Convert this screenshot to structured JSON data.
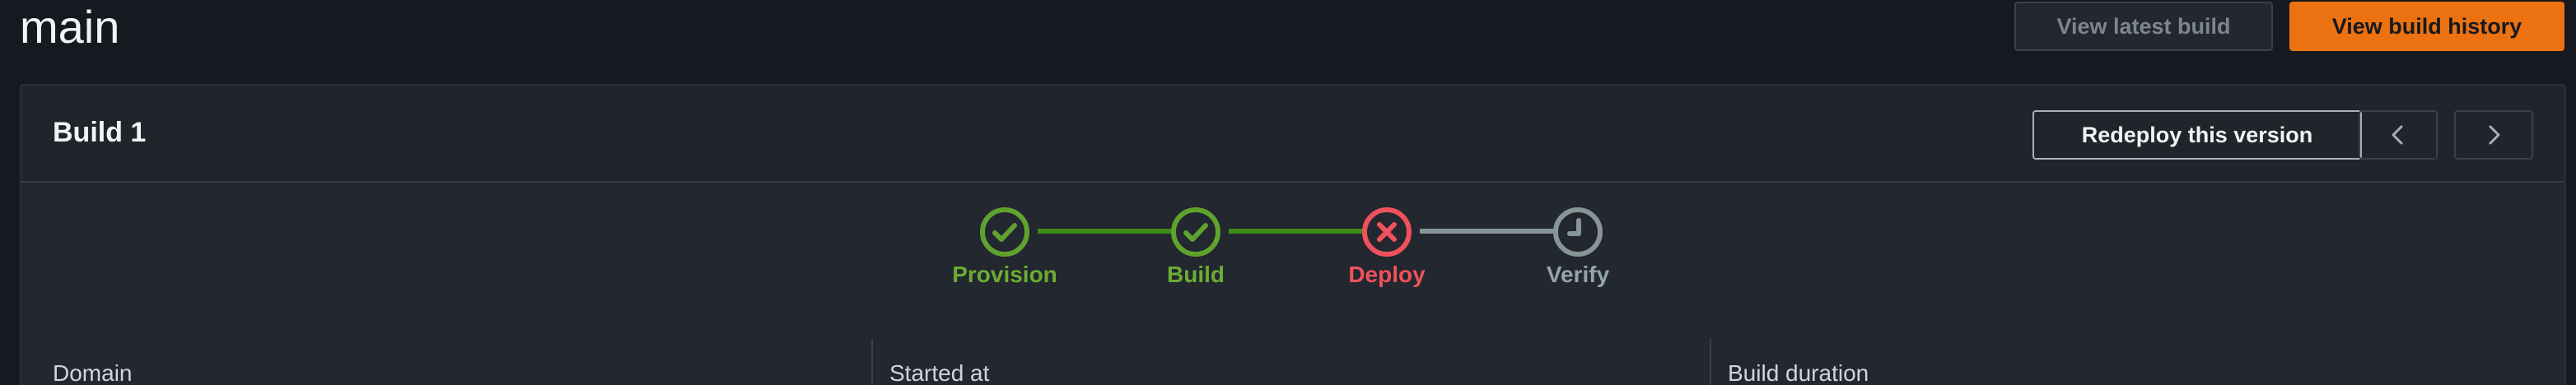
{
  "header": {
    "title": "main",
    "view_latest_label": "View latest build",
    "view_history_label": "View build history"
  },
  "build_panel": {
    "title": "Build 1",
    "redeploy_label": "Redeploy this version",
    "prev_icon": "chevron-left-icon",
    "next_icon": "chevron-right-icon"
  },
  "stepper": {
    "steps": [
      {
        "label": "Provision",
        "status": "success",
        "icon": "check-circle-icon"
      },
      {
        "label": "Build",
        "status": "success",
        "icon": "check-circle-icon"
      },
      {
        "label": "Deploy",
        "status": "failed",
        "icon": "x-circle-icon"
      },
      {
        "label": "Verify",
        "status": "pending",
        "icon": "clock-circle-icon"
      }
    ]
  },
  "details": {
    "columns": [
      {
        "label": "Domain"
      },
      {
        "label": "Started at"
      },
      {
        "label": "Build duration"
      }
    ]
  },
  "colors": {
    "accent": "#ec7211",
    "success": "#5fa32e",
    "error": "#f0515a",
    "pending": "#879596"
  }
}
